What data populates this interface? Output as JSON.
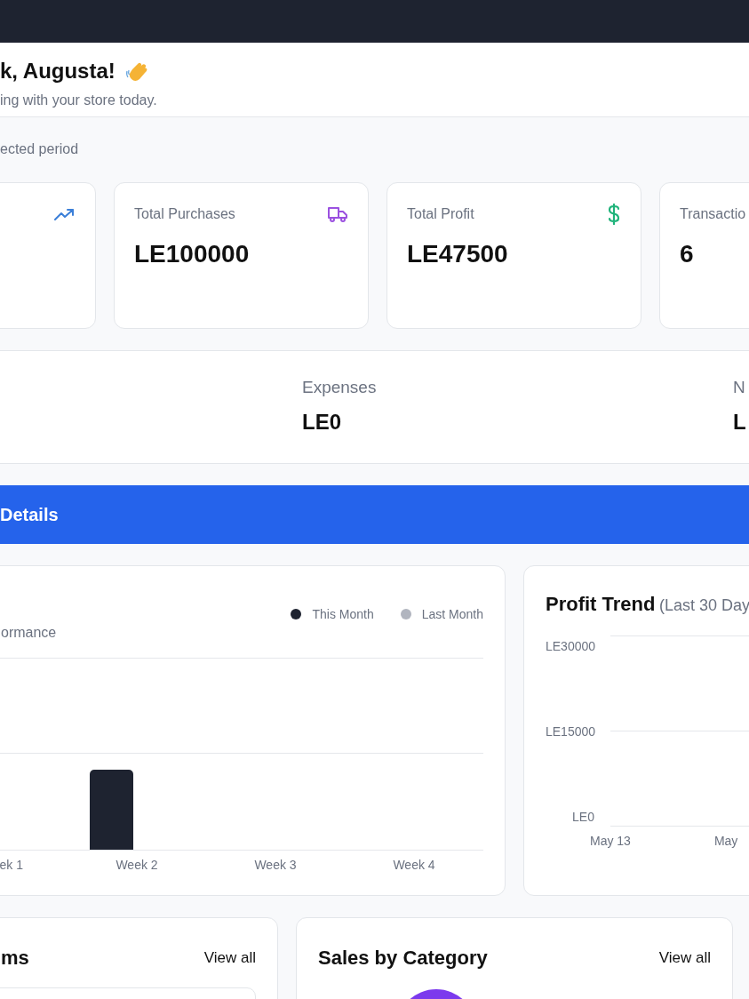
{
  "header": {
    "title": "k, Augusta!",
    "subtitle": "ing with your store today."
  },
  "period_note": "ected period",
  "stat_cards": [
    {
      "kind": "trend"
    },
    {
      "kind": "truck",
      "label": "Total Purchases",
      "value": "LE100000"
    },
    {
      "kind": "dollar",
      "label": "Total Profit",
      "value": "LE47500"
    },
    {
      "kind": "plain",
      "label": "Transactio",
      "value": "6"
    }
  ],
  "summary": [
    {
      "label": "Expenses",
      "value": "LE0"
    },
    {
      "label": "N",
      "value": "L"
    }
  ],
  "section_bar": {
    "title": "Details"
  },
  "sales_chart": {
    "subtitle": "ormance",
    "legend": [
      {
        "label": "This Month",
        "color": "#1e2330"
      },
      {
        "label": "Last Month",
        "color": "#b1b5bf"
      }
    ],
    "x_labels": [
      "ek 1",
      "Week 2",
      "Week 3",
      "Week 4"
    ]
  },
  "profit_chart": {
    "title": "Profit Trend",
    "subtitle": "(Last 30 Day",
    "y_labels": [
      "LE30000",
      "LE15000",
      "LE0"
    ],
    "x_labels": [
      "May 13",
      "May"
    ]
  },
  "bottom_cards": [
    {
      "kind": "list",
      "title": "ms",
      "link": "View all"
    },
    {
      "kind": "donut",
      "title": "Sales by Category",
      "link": "View all"
    }
  ]
}
